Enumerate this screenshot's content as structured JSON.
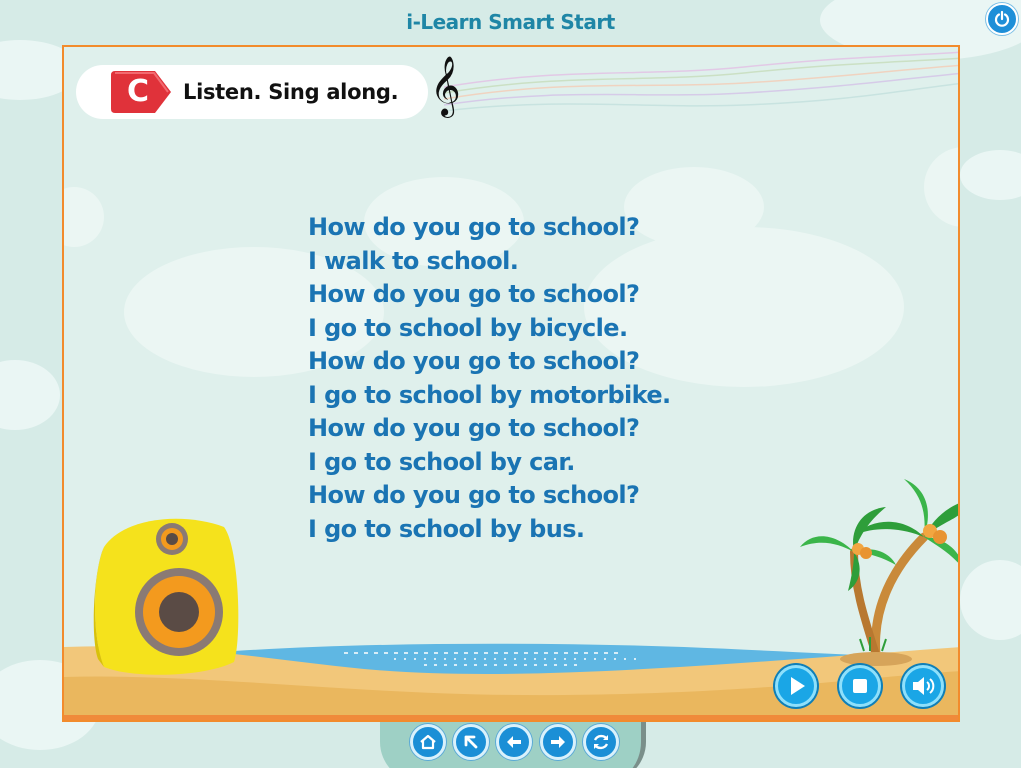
{
  "app": {
    "title": "i-Learn Smart Start"
  },
  "section": {
    "letter": "C",
    "instruction": "Listen. Sing along.",
    "badge_color": "#e0323a"
  },
  "lyrics": [
    "How do you go to school?",
    "I walk to school.",
    "How do you go to school?",
    "I go to school by bicycle.",
    "How do you go to school?",
    "I go to school by motorbike.",
    "How do you go to school?",
    "I go to school by car.",
    "How do you go to school?",
    "I go to school by bus."
  ],
  "colors": {
    "lyrics": "#1a74b3",
    "frame_border": "#f28b2c",
    "title": "#1f86a6",
    "button": "#1aa6e6"
  },
  "icons": {
    "power": "power-icon",
    "clef": "treble-clef-icon",
    "player": [
      "play-icon",
      "stop-icon",
      "volume-icon"
    ],
    "nav": [
      "home-icon",
      "arrow-up-left-icon",
      "arrow-left-icon",
      "arrow-right-icon",
      "refresh-icon"
    ]
  }
}
